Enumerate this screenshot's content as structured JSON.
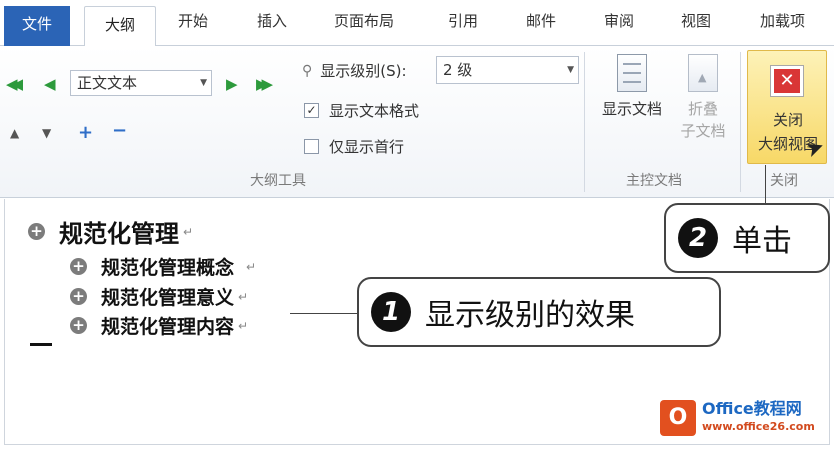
{
  "tabs": [
    {
      "label": "文件"
    },
    {
      "label": "大纲"
    },
    {
      "label": "开始"
    },
    {
      "label": "插入"
    },
    {
      "label": "页面布局"
    },
    {
      "label": "引用"
    },
    {
      "label": "邮件"
    },
    {
      "label": "审阅"
    },
    {
      "label": "视图"
    },
    {
      "label": "加载项"
    }
  ],
  "outline_tools": {
    "level_combo_value": "正文文本",
    "show_level_label": "显示级别(S):",
    "show_level_value": "2 级",
    "show_text_format_label": "显示文本格式",
    "show_text_format_checked": true,
    "show_first_line_label": "仅显示首行",
    "show_first_line_checked": false,
    "group_label": "大纲工具",
    "promote_icon": "promote-to-heading1-icon",
    "demote_icon": "demote-to-body-icon"
  },
  "master_doc": {
    "show_document_label": "显示文档",
    "collapse_label_1": "折叠",
    "collapse_label_2": "子文档",
    "group_label": "主控文档"
  },
  "close_group": {
    "button_line1": "关闭",
    "button_line2": "大纲视图",
    "group_label": "关闭"
  },
  "outline": {
    "level1": "规范化管理",
    "level2_items": [
      "规范化管理概念",
      "规范化管理意义",
      "规范化管理内容"
    ]
  },
  "callouts": {
    "one_number": "1",
    "one_text": "显示级别的效果",
    "two_number": "2",
    "two_text": "单击"
  },
  "watermark": {
    "logo": "O",
    "line1": "Office教程网",
    "line2": "www.office26.com"
  }
}
